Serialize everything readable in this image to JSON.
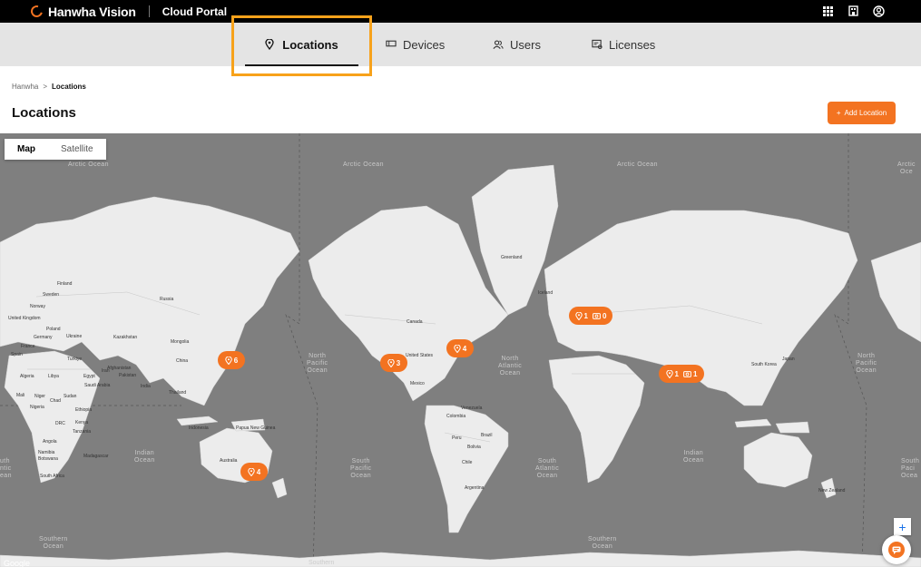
{
  "header": {
    "brand_name": "Hanwha Vision",
    "portal_name": "Cloud Portal",
    "icons": [
      "apps-grid-icon",
      "building-icon",
      "user-account-icon"
    ]
  },
  "nav": {
    "tabs": [
      {
        "label": "Locations",
        "icon": "map-pin-icon",
        "active": true
      },
      {
        "label": "Devices",
        "icon": "device-icon",
        "active": false
      },
      {
        "label": "Users",
        "icon": "users-icon",
        "active": false
      },
      {
        "label": "Licenses",
        "icon": "license-icon",
        "active": false
      }
    ]
  },
  "breadcrumb": {
    "root": "Hanwha",
    "separator": ">",
    "current": "Locations"
  },
  "page": {
    "title": "Locations",
    "add_button_label": "Add Location",
    "add_button_icon": "+"
  },
  "map": {
    "toggle": {
      "map": "Map",
      "satellite": "Satellite",
      "selected": "Map"
    },
    "ocean_labels": [
      "Arctic Ocean",
      "Arctic Ocean",
      "Arctic Ocean",
      "Arctic Oce",
      "North\nPacific\nOcean",
      "North\nAtlantic\nOcean",
      "North\nPacific\nOcean",
      "Indian\nOcean",
      "South\nPacific\nOcean",
      "South\nAtlantic\nOcean",
      "Indian\nOcean",
      "uth\nntic\nean",
      "South\nPaci\nOcea",
      "Southern\nOcean",
      "Southern\nOcean",
      "Southern"
    ],
    "place_labels": [
      "Greenland",
      "Canada",
      "United States",
      "Mexico",
      "Venezuela",
      "Colombia",
      "Peru",
      "Brazil",
      "Bolivia",
      "Chile",
      "Argentina",
      "Russia",
      "Mongolia",
      "China",
      "Kazakhstan",
      "India",
      "Australia",
      "Indonesia",
      "Papua New Guinea",
      "Egypt",
      "Libya",
      "Algeria",
      "Sudan",
      "Chad",
      "Niger",
      "Mali",
      "Nigeria",
      "Ethiopia",
      "Kenya",
      "Tanzania",
      "DRC",
      "Angola",
      "Namibia",
      "Botswana",
      "South Africa",
      "Madagascar",
      "Saudi Arabia",
      "Iran",
      "Pakistan",
      "Afghanistan",
      "Turkiye",
      "Ukraine",
      "Poland",
      "Germany",
      "France",
      "Spain",
      "Sweden",
      "Finland",
      "Norway",
      "United Kingdom",
      "Thailand",
      "South Korea",
      "Japan",
      "New Zealand",
      "Iceland"
    ],
    "markers": [
      {
        "locations": "6",
        "devices": null
      },
      {
        "locations": "3",
        "devices": null
      },
      {
        "locations": "4",
        "devices": null
      },
      {
        "locations": "4",
        "devices": null
      },
      {
        "locations": "1",
        "devices": "0"
      },
      {
        "locations": "1",
        "devices": "1"
      }
    ],
    "zoom_in": "+",
    "attribution": "Google"
  },
  "colors": {
    "accent": "#f37321",
    "highlight": "#f7a21b",
    "ocean": "#7f7f7f",
    "land": "#e9e9e9"
  }
}
